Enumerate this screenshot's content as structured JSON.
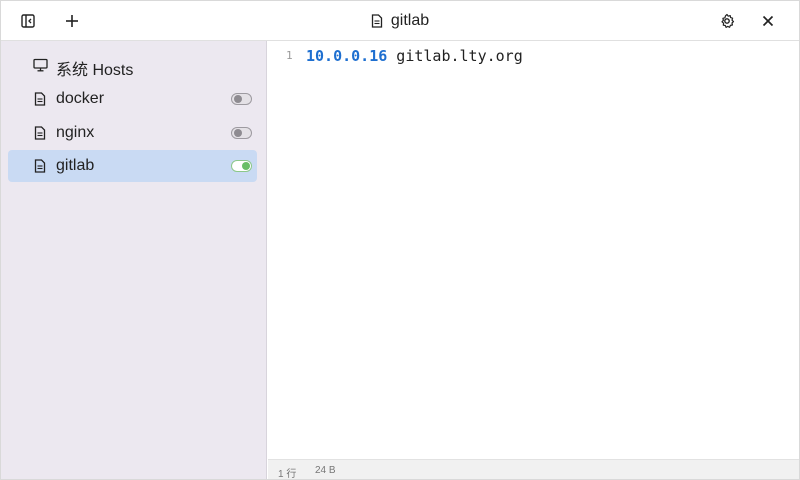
{
  "header": {
    "title": "gitlab"
  },
  "sidebar": {
    "items": [
      {
        "label": "系统 Hosts",
        "icon": "monitor-icon"
      },
      {
        "label": "docker",
        "icon": "file-icon",
        "enabled": false
      },
      {
        "label": "nginx",
        "icon": "file-icon",
        "enabled": false
      },
      {
        "label": "gitlab",
        "icon": "file-icon",
        "enabled": true,
        "selected": true
      }
    ]
  },
  "editor": {
    "line_number": "1",
    "ip": "10.0.0.16",
    "hostname": " gitlab.lty.org"
  },
  "status": {
    "lines": "1 行",
    "size": "24 B"
  },
  "colors": {
    "sidebar_bg": "#ece8f0",
    "selected_bg": "#c9daf3",
    "ip_color": "#1e6fd0",
    "toggle_on": "#69be66"
  }
}
